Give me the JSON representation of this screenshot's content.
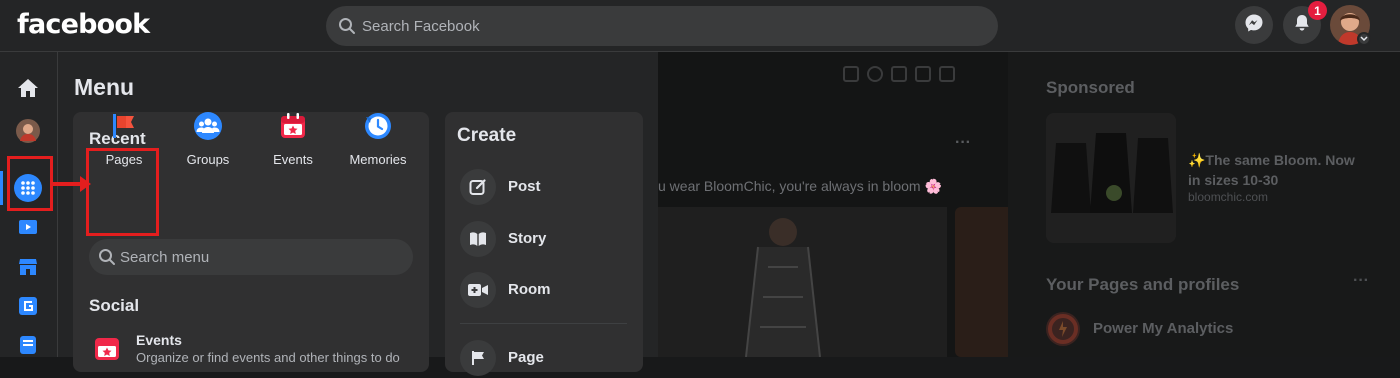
{
  "topbar": {
    "logo": "facebook",
    "search_placeholder": "Search Facebook",
    "notification_count": "1"
  },
  "left_rail": {
    "items": [
      "home-icon",
      "profile-avatar",
      "menu-grid-icon",
      "watch-icon",
      "marketplace-icon",
      "gaming-icon",
      "feeds-icon"
    ]
  },
  "menu": {
    "title": "Menu",
    "recent": {
      "title": "Recent",
      "items": [
        {
          "label": "Pages",
          "icon": "flag-icon"
        },
        {
          "label": "Groups",
          "icon": "groups-icon"
        },
        {
          "label": "Events",
          "icon": "calendar-star-icon"
        },
        {
          "label": "Memories",
          "icon": "clock-icon"
        }
      ]
    },
    "search_placeholder": "Search menu",
    "social": {
      "title": "Social",
      "items": [
        {
          "label": "Events",
          "description": "Organize or find events and other things to do"
        }
      ]
    },
    "create": {
      "title": "Create",
      "items": [
        {
          "label": "Post",
          "icon": "compose-icon"
        },
        {
          "label": "Story",
          "icon": "book-icon"
        },
        {
          "label": "Room",
          "icon": "video-plus-icon"
        },
        {
          "label": "Page",
          "icon": "flag-icon"
        }
      ]
    }
  },
  "feed": {
    "ad_text": "u wear BloomChic, you're always in bloom 🌸",
    "more": "···"
  },
  "right_column": {
    "sponsored_title": "Sponsored",
    "ad_headline": "✨The same Bloom. Now in sizes 10-30",
    "ad_domain": "bloomchic.com",
    "pages_title": "Your Pages and profiles",
    "pages_more": "···",
    "page_name": "Power My Analytics"
  },
  "colors": {
    "accent": "#2d88ff",
    "highlight": "#e41e1e",
    "badge": "#e41e3f"
  }
}
